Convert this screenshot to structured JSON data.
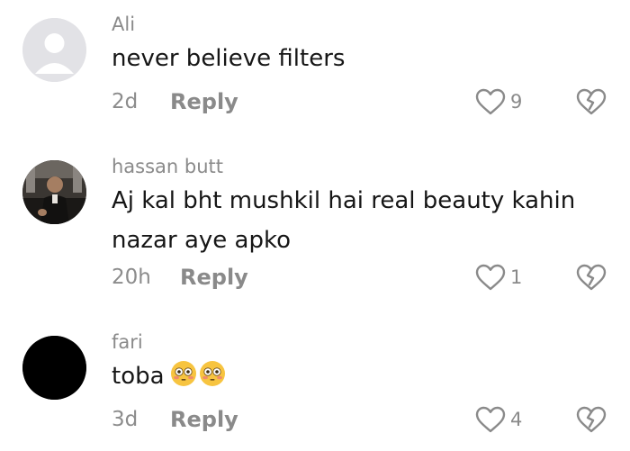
{
  "comments": [
    {
      "username": "Ali",
      "text": "never believe filters",
      "time": "2d",
      "reply_label": "Reply",
      "likes": "9",
      "avatar": "default-avatar-icon"
    },
    {
      "username": "hassan butt",
      "text_line1": "Aj kal bht mushkil hai real beauty kahin",
      "text_line2": "nazar aye apko",
      "time": "20h",
      "reply_label": "Reply",
      "likes": "1",
      "avatar": "profile-photo"
    },
    {
      "username": "fari",
      "text": "toba",
      "emojis": [
        "flushed-face-emoji",
        "flushed-face-emoji"
      ],
      "time": "3d",
      "reply_label": "Reply",
      "likes": "4",
      "avatar": "black-avatar"
    }
  ],
  "colors": {
    "muted": "#8a8a8a",
    "text": "#161616",
    "emoji_face": "#f7c440"
  }
}
